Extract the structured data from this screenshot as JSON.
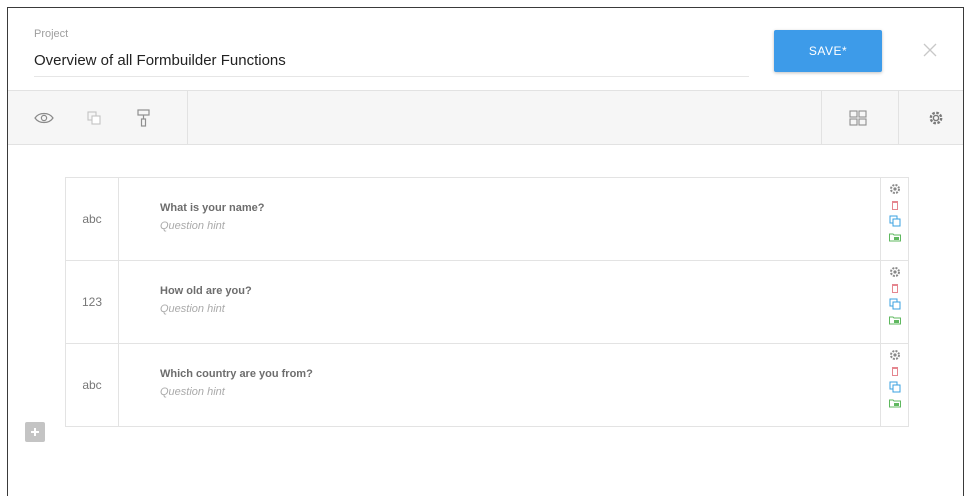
{
  "header": {
    "project_label": "Project",
    "project_name": "Overview of all Formbuilder Functions",
    "save_label": "SAVE*",
    "close_icon": "close-icon"
  },
  "toolbar": {
    "left_icons": [
      "eye-icon",
      "duplicate-icon",
      "brush-icon"
    ],
    "right_icons": [
      "layout-icon",
      "gear-icon"
    ]
  },
  "questions": [
    {
      "type_label": "abc",
      "title": "What is your name?",
      "hint": "Question hint"
    },
    {
      "type_label": "123",
      "title": "How old are you?",
      "hint": "Question hint"
    },
    {
      "type_label": "abc",
      "title": "Which country are you from?",
      "hint": "Question hint"
    }
  ],
  "row_actions": [
    "gear-icon",
    "trash-icon",
    "copy-icon",
    "folder-icon"
  ],
  "colors": {
    "accent": "#3d9be9",
    "trash": "#e5868f",
    "copy": "#3aa0e0",
    "folder": "#5fb85f",
    "gear": "#888888"
  },
  "add_icon": "plus-icon"
}
